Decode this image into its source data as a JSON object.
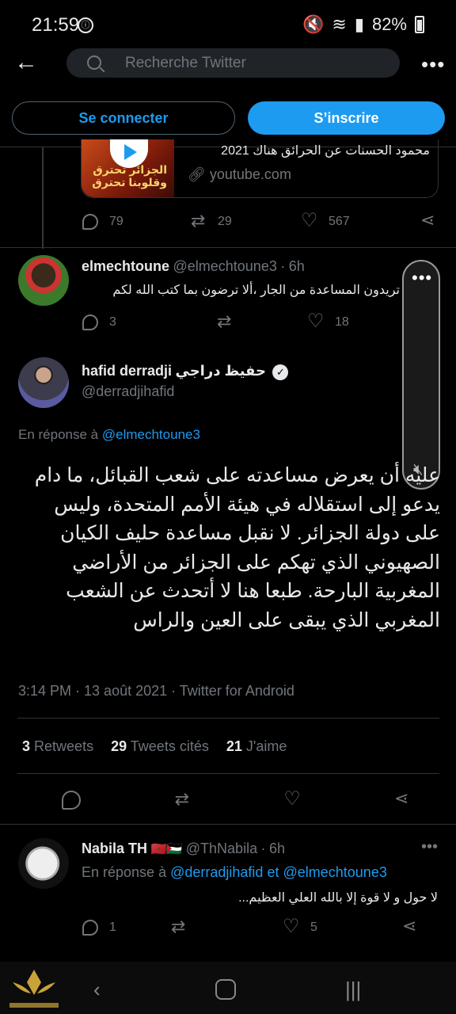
{
  "status_bar": {
    "time": "21:59",
    "battery": "82%"
  },
  "topbar": {
    "search_placeholder": "Recherche Twitter"
  },
  "auth": {
    "login": "Se connecter",
    "signup": "S’inscrire"
  },
  "card": {
    "title": "محمود الحسنات عن الحرائق هناك 2021",
    "domain": "youtube.com",
    "thumb_text": "الجزائر تحترق وقلوبنا تحترق"
  },
  "tweet0_actions": {
    "replies": "79",
    "retweets": "29",
    "likes": "567"
  },
  "tweet1": {
    "name": "elmechtoune",
    "handle": "@elmechtoune3",
    "age": "6h",
    "body": "تريدون المساعدة من الجار ،ألا ترضون بما كتب الله لكم",
    "replies": "3",
    "likes": "18"
  },
  "main_tweet": {
    "name": "hafid derradji",
    "name_ar": "حفيظ دراجي",
    "handle": "@derradjihafid",
    "reply_to_prefix": "En réponse à",
    "reply_to": "@elmechtoune3",
    "body": "عليه أن يعرض مساعدته على شعب القبائل، ما دام يدعو إلى استقلاله في هيئة الأمم المتحدة، وليس على دولة الجزائر. لا نقبل مساعدة حليف الكيان الصهيوني الذي تهكم على الجزائر من الأراضي المغربية البارحة. طبعا هنا لا أتحدث عن الشعب المغربي الذي يبقى على العين والراس",
    "meta": "3:14 PM · 13 août 2021 · Twitter for Android",
    "stats": {
      "retweets_count": "3",
      "retweets_label": "Retweets",
      "quotes_count": "29",
      "quotes_label": "Tweets cités",
      "likes_count": "21",
      "likes_label": "J'aime"
    }
  },
  "tweet3": {
    "name": "Nabila TH",
    "flags": "🇲🇦🇵🇸",
    "handle": "@ThNabila",
    "age": "6h",
    "reply_prefix": "En réponse à",
    "reply_a": "@derradjihafid",
    "reply_and": "et",
    "reply_b": "@elmechtoune3",
    "body": "لا حول و لا قوة إلا بالله العلي العظيم...",
    "replies": "1",
    "likes": "5"
  }
}
